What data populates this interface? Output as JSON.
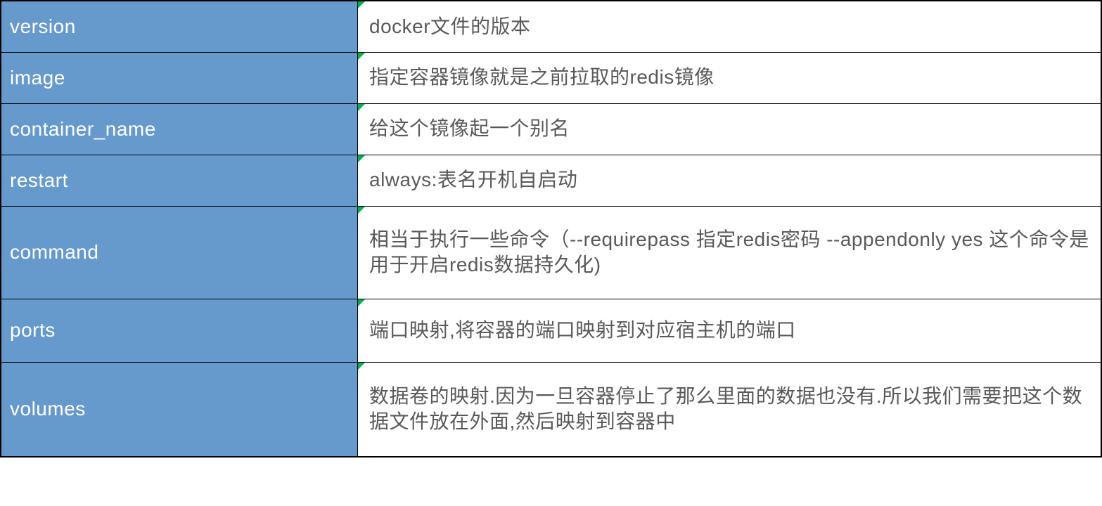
{
  "rows": [
    {
      "key": "version",
      "value": "docker文件的版本"
    },
    {
      "key": "image",
      "value": "指定容器镜像就是之前拉取的redis镜像"
    },
    {
      "key": "container_name",
      "value": "给这个镜像起一个别名"
    },
    {
      "key": "restart",
      "value": "always:表名开机自启动"
    },
    {
      "key": "command",
      "value": " 相当于执行一些命令（--requirepass 指定redis密码  --appendonly yes 这个命令是用于开启redis数据持久化)"
    },
    {
      "key": "ports",
      "value": " 端口映射,将容器的端口映射到对应宿主机的端口"
    },
    {
      "key": "volumes",
      "value": " 数据卷的映射.因为一旦容器停止了那么里面的数据也没有.所以我们需要把这个数据文件放在外面,然后映射到容器中"
    }
  ]
}
